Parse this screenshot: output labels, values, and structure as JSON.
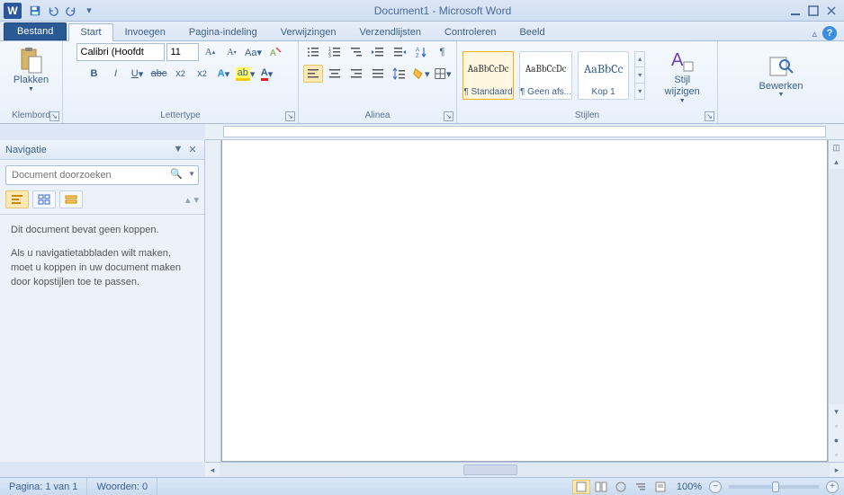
{
  "title": "Document1 - Microsoft Word",
  "tabs": {
    "file": "Bestand",
    "items": [
      "Start",
      "Invoegen",
      "Pagina-indeling",
      "Verwijzingen",
      "Verzendlijsten",
      "Controleren",
      "Beeld"
    ],
    "active": 0
  },
  "clipboard": {
    "paste": "Plakken",
    "label": "Klembord"
  },
  "font": {
    "name": "Calibri (Hoofdt",
    "size": "11",
    "label": "Lettertype"
  },
  "paragraph": {
    "label": "Alinea"
  },
  "styles": {
    "label": "Stijlen",
    "items": [
      {
        "preview": "AaBbCcDc",
        "name": "¶ Standaard"
      },
      {
        "preview": "AaBbCcDc",
        "name": "¶ Geen afs..."
      },
      {
        "preview": "AaBbCc",
        "name": "Kop 1"
      }
    ],
    "change": "Stijl wijzigen"
  },
  "editing": {
    "label": "Bewerken"
  },
  "nav": {
    "title": "Navigatie",
    "placeholder": "Document doorzoeken",
    "msg1": "Dit document bevat geen koppen.",
    "msg2": "Als u navigatietabbladen wilt maken, moet u koppen in uw document maken door kopstijlen toe te passen."
  },
  "status": {
    "page": "Pagina: 1 van 1",
    "words": "Woorden: 0",
    "zoom": "100%"
  }
}
